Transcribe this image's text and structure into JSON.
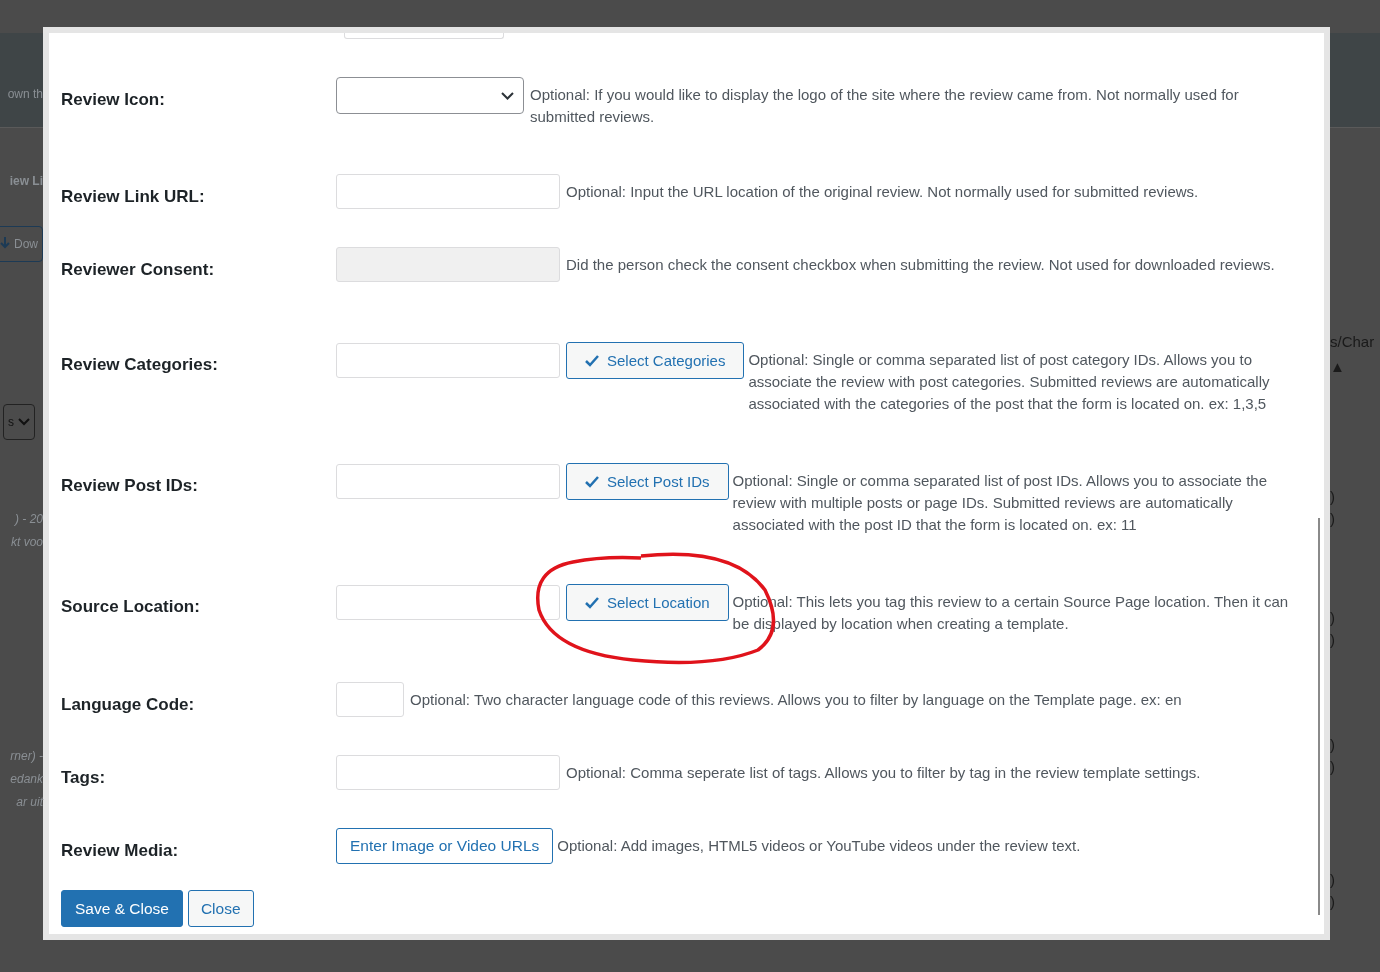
{
  "backdrop": {
    "left": [
      {
        "kind": "text",
        "text": "own th"
      },
      {
        "kind": "heading",
        "text": "iew Li"
      },
      {
        "kind": "button",
        "text": "Dow"
      },
      {
        "kind": "select",
        "text": "s"
      },
      {
        "kind": "italic",
        "text": ") - 20"
      },
      {
        "kind": "italic",
        "text": "kt voo"
      },
      {
        "kind": "italic",
        "text": "rner) -"
      },
      {
        "kind": "italic",
        "text": "edank"
      },
      {
        "kind": "italic",
        "text": "ar uit"
      }
    ],
    "right": [
      {
        "kind": "text",
        "text": "s/Char"
      },
      {
        "kind": "text",
        "text": "▲"
      },
      {
        "kind": "text",
        "text": ")"
      },
      {
        "kind": "text",
        "text": ")"
      },
      {
        "kind": "text",
        "text": ")"
      },
      {
        "kind": "text",
        "text": ")"
      },
      {
        "kind": "text",
        "text": ")"
      },
      {
        "kind": "text",
        "text": ")"
      },
      {
        "kind": "text",
        "text": ")"
      },
      {
        "kind": "text",
        "text": ")"
      }
    ]
  },
  "fields": [
    {
      "label": "Review Icon:",
      "kind": "select",
      "description": "Optional: If you would like to display the logo of the site where the review came from. Not normally used for submitted reviews."
    },
    {
      "label": "Review Link URL:",
      "kind": "text",
      "description": "Optional: Input the URL location of the original review. Not normally used for submitted reviews."
    },
    {
      "label": "Reviewer Consent:",
      "kind": "text",
      "disabled": true,
      "description": "Did the person check the consent checkbox when submitting the review. Not used for downloaded reviews."
    },
    {
      "label": "Review Categories:",
      "kind": "picker",
      "button": "Select Categories",
      "description": "Optional: Single or comma separated list of post category IDs. Allows you to associate the review with post categories. Submitted reviews are automatically associated with the categories of the post that the form is located on. ex: 1,3,5"
    },
    {
      "label": "Review Post IDs:",
      "kind": "picker",
      "button": "Select Post IDs",
      "description": "Optional: Single or comma separated list of post IDs. Allows you to associate the review with multiple posts or page IDs. Submitted reviews are automatically associated with the post ID that the form is located on. ex: 11"
    },
    {
      "label": "Source Location:",
      "kind": "picker",
      "button": "Select Location",
      "circled": true,
      "description": "Optional: This lets you tag this review to a certain Source Page location. Then it can be displayed by location when creating a template."
    },
    {
      "label": "Language Code:",
      "kind": "short",
      "description": "Optional: Two character language code of this reviews. Allows you to filter by language on the Template page. ex: en"
    },
    {
      "label": "Tags:",
      "kind": "text",
      "description": "Optional: Comma seperate list of tags. Allows you to filter by tag in the review template settings."
    },
    {
      "label": "Review Media:",
      "kind": "media",
      "button": "Enter Image or Video URLs",
      "description": "Optional: Add images, HTML5 videos or YouTube videos under the review text."
    }
  ],
  "actions": [
    {
      "label": "Save & Close",
      "kind": "primary"
    },
    {
      "label": "Close",
      "kind": "secondary"
    }
  ]
}
